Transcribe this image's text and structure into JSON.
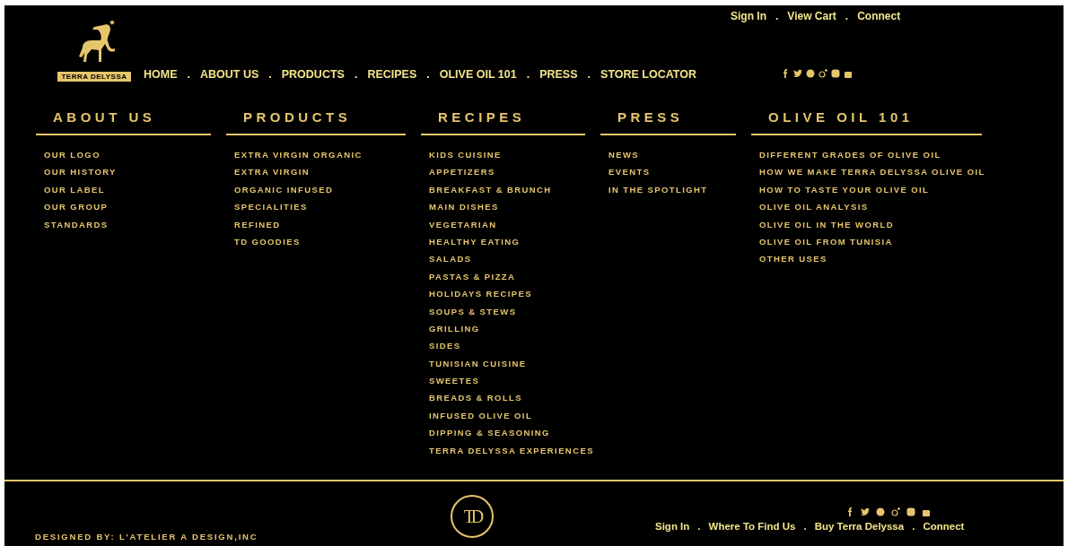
{
  "top_links": [
    {
      "label": "Sign In"
    },
    {
      "separator": ".",
      "label": "View Cart"
    },
    {
      "separator": ".",
      "label": "Connect"
    }
  ],
  "logo": {
    "wordmark": "TERRA DELYSSA"
  },
  "nav": [
    {
      "label": "HOME"
    },
    {
      "separator": ".",
      "label": "ABOUT US"
    },
    {
      "separator": ".",
      "label": "PRODUCTS"
    },
    {
      "separator": ".",
      "label": "RECIPES"
    },
    {
      "separator": ".",
      "label": "OLIVE OIL 101"
    },
    {
      "separator": ".",
      "label": "PRESS"
    },
    {
      "separator": ".",
      "label": "STORE LOCATOR"
    }
  ],
  "menu_columns": [
    {
      "heading": "ABOUT US",
      "items": [
        "OUR LOGO",
        "OUR HISTORY",
        "OUR LABEL",
        "OUR GROUP",
        "STANDARDS"
      ]
    },
    {
      "heading": "PRODUCTS",
      "items": [
        "EXTRA VIRGIN ORGANIC",
        "EXTRA VIRGIN",
        "ORGANIC INFUSED",
        "SPECIALITIES",
        "REFINED",
        "TD GOODIES"
      ]
    },
    {
      "heading": "RECIPES",
      "items": [
        "KIDS CUISINE",
        "APPETIZERS",
        "BREAKFAST & BRUNCH",
        "MAIN DISHES",
        "VEGETARIAN",
        "HEALTHY EATING",
        "SALADS",
        "PASTAS & PIZZA",
        "HOLIDAYS RECIPES",
        "SOUPS & STEWS",
        "GRILLING",
        "SIDES",
        "TUNISIAN CUISINE",
        "SWEETES",
        "BREADS & ROLLS",
        "INFUSED OLIVE OIL",
        "DIPPING & SEASONING",
        "TERRA DELYSSA EXPERIENCES"
      ]
    },
    {
      "heading": "PRESS",
      "items": [
        "NEWS",
        "EVENTS",
        "IN THE SPOTLIGHT"
      ]
    },
    {
      "heading": "OLIVE OIL 101",
      "items": [
        "DIFFERENT GRADES OF OLIVE OIL",
        "HOW WE MAKE TERRA DELYSSA OLIVE OIL",
        "HOW TO TASTE YOUR OLIVE OIL",
        "OLIVE OIL ANALYSIS",
        "OLIVE OIL IN THE WORLD",
        "OLIVE OIL FROM TUNISIA",
        "OTHER USES"
      ]
    }
  ],
  "footer": {
    "credit": "DESIGNED BY: L'ATELIER A DESIGN,INC",
    "monogram": "TD",
    "links": [
      {
        "label": "Sign In"
      },
      {
        "separator": ".",
        "label": "Where To Find Us"
      },
      {
        "separator": ".",
        "label": "Buy Terra Delyssa"
      },
      {
        "separator": ".",
        "label": "Connect"
      }
    ]
  }
}
